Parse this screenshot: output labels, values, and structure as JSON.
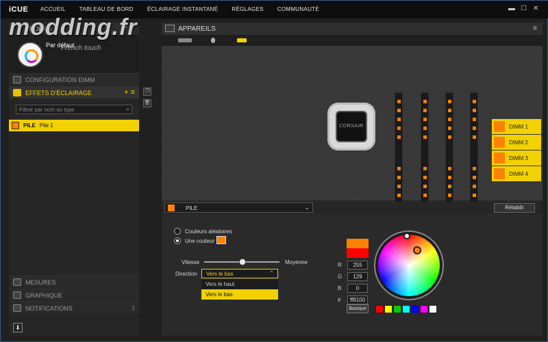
{
  "app": {
    "logo": "iCUE",
    "nav": [
      "ACCUEIL",
      "TABLEAU DE BORD",
      "ÉCLAIRAGE INSTANTANÉ",
      "RÉGLAGES",
      "COMMUNAUTÉ"
    ]
  },
  "watermark": {
    "text": "modding.fr",
    "sub": "French touch"
  },
  "left": {
    "profiles_title": "PROFILS",
    "profile_name": "Par défaut",
    "sections": {
      "dimm": "CONFIGURATION DIMM",
      "lighting": "EFFETS D'ÉCLAIRAGE",
      "measures": "MESURES",
      "graph": "GRAPHIQUE",
      "notifications": "NOTIFICATIONS",
      "notif_count": "1"
    },
    "filter_placeholder": "Filtrer par nom ou type",
    "effect": {
      "type": "PILE",
      "name": "Pile 1"
    }
  },
  "right": {
    "devices_title": "APPAREILS",
    "pump_brand": "CORSAIR",
    "dimms": [
      "DIMM 1",
      "DIMM 2",
      "DIMM 3",
      "DIMM 4"
    ],
    "effect_select": "PILE",
    "reset_label": "Rétablir",
    "options": {
      "random": "Couleurs aléatoires",
      "single": "Une couleur"
    },
    "speed_label": "Vitesse",
    "speed_value_label": "Moyenne",
    "speed_level": 0.5,
    "direction_label": "Direction",
    "direction_value": "Vers le bas",
    "direction_options": [
      "Vers le haut",
      "Vers le bas"
    ],
    "rgb": {
      "r_label": "R",
      "g_label": "G",
      "b_label": "B",
      "hex_label": "#",
      "r": "255",
      "g": "129",
      "b": "0",
      "hex": "ff8100"
    },
    "basic_label": "Basique",
    "colors": {
      "accent": "#f2d100",
      "selected": "#ff8100"
    },
    "swatches": [
      "#ff0000",
      "#ffff00",
      "#00cc00",
      "#00ffff",
      "#0000ff",
      "#ff00ff",
      "#ffffff"
    ]
  }
}
